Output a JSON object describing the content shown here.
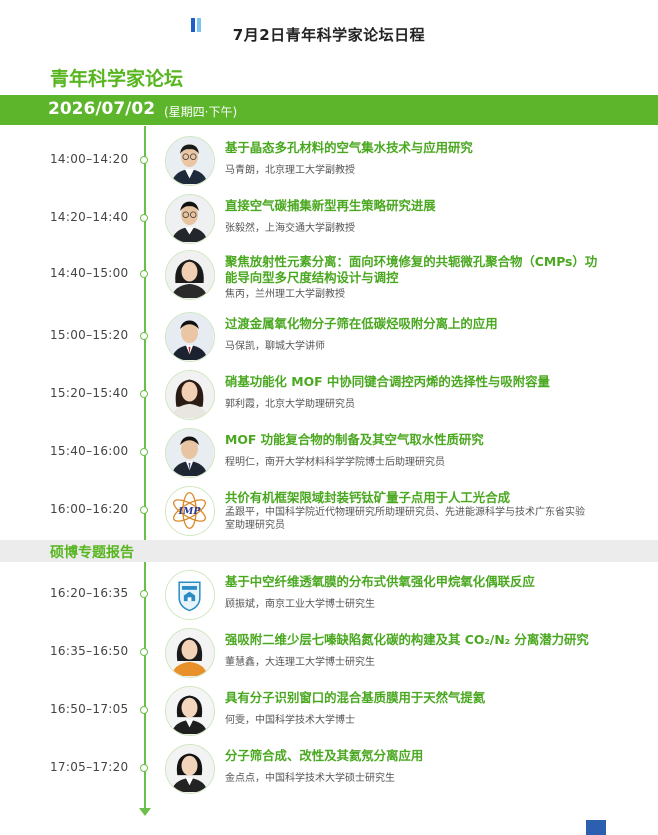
{
  "header": {
    "title": "7月2日青年科学家论坛日程"
  },
  "section_main": "青年科学家论坛",
  "date_bar": {
    "date": "2026/07/02",
    "sub": "(星期四·下午)"
  },
  "section_sub": "硕博专题报告",
  "colors": {
    "accent_green": "#5cb52a",
    "title_green": "#4aa820",
    "header_blue": "#1e5fc9"
  },
  "talks": [
    {
      "time": "14:00–14:20",
      "title": "基于晶态多孔材料的空气集水技术与应用研究",
      "speaker": "马青朗，北京理工大学副教授",
      "avatar": "male-portrait-glasses"
    },
    {
      "time": "14:20–14:40",
      "title": "直接空气碳捕集新型再生策略研究进展",
      "speaker": "张毅然，上海交通大学副教授",
      "avatar": "male-portrait-glasses"
    },
    {
      "time": "14:40–15:00",
      "title": "聚焦放射性元素分离：面向环境修复的共轭微孔聚合物（CMPs）功能导向型多尺度结构设计与调控",
      "speaker": "焦丙，兰州理工大学副教授",
      "avatar": "female-portrait"
    },
    {
      "time": "15:00–15:20",
      "title": "过渡金属氧化物分子筛在低碳烃吸附分离上的应用",
      "speaker": "马保凯，聊城大学讲师",
      "avatar": "male-portrait"
    },
    {
      "time": "15:20–15:40",
      "title": "硝基功能化 MOF 中协同键合调控丙烯的选择性与吸附容量",
      "speaker": "郭利霞，北京大学助理研究员",
      "avatar": "female-portrait"
    },
    {
      "time": "15:40–16:00",
      "title": "MOF 功能复合物的制备及其空气取水性质研究",
      "speaker": "程明仁，南开大学材料科学学院博士后助理研究员",
      "avatar": "male-portrait"
    },
    {
      "time": "16:00–16:20",
      "title": "共价有机框架限域封装钙钛矿量子点用于人工光合成",
      "speaker": "孟跟平，中国科学院近代物理研究所助理研究员、先进能源科学与技术广东省实验室助理研究员",
      "avatar": "institute-logo",
      "logo_text": "IMP"
    },
    {
      "time": "16:20–16:35",
      "title": "基于中空纤维透氧膜的分布式供氧强化甲烷氧化偶联反应",
      "speaker": "顾振斌，南京工业大学博士研究生",
      "avatar": "university-badge-logo"
    },
    {
      "time": "16:35–16:50",
      "title": "强吸附二维少层七嗪缺陷氮化碳的构建及其 CO₂/N₂ 分离潜力研究",
      "speaker": "董慧鑫，大连理工大学博士研究生",
      "avatar": "female-portrait"
    },
    {
      "time": "16:50–17:05",
      "title": "具有分子识别窗口的混合基质膜用于天然气提氦",
      "speaker": "何雯，中国科学技术大学博士",
      "avatar": "female-portrait"
    },
    {
      "time": "17:05–17:20",
      "title": "分子筛合成、改性及其氦氖分离应用",
      "speaker": "金点点，中国科学技术大学硕士研究生",
      "avatar": "female-portrait"
    }
  ]
}
